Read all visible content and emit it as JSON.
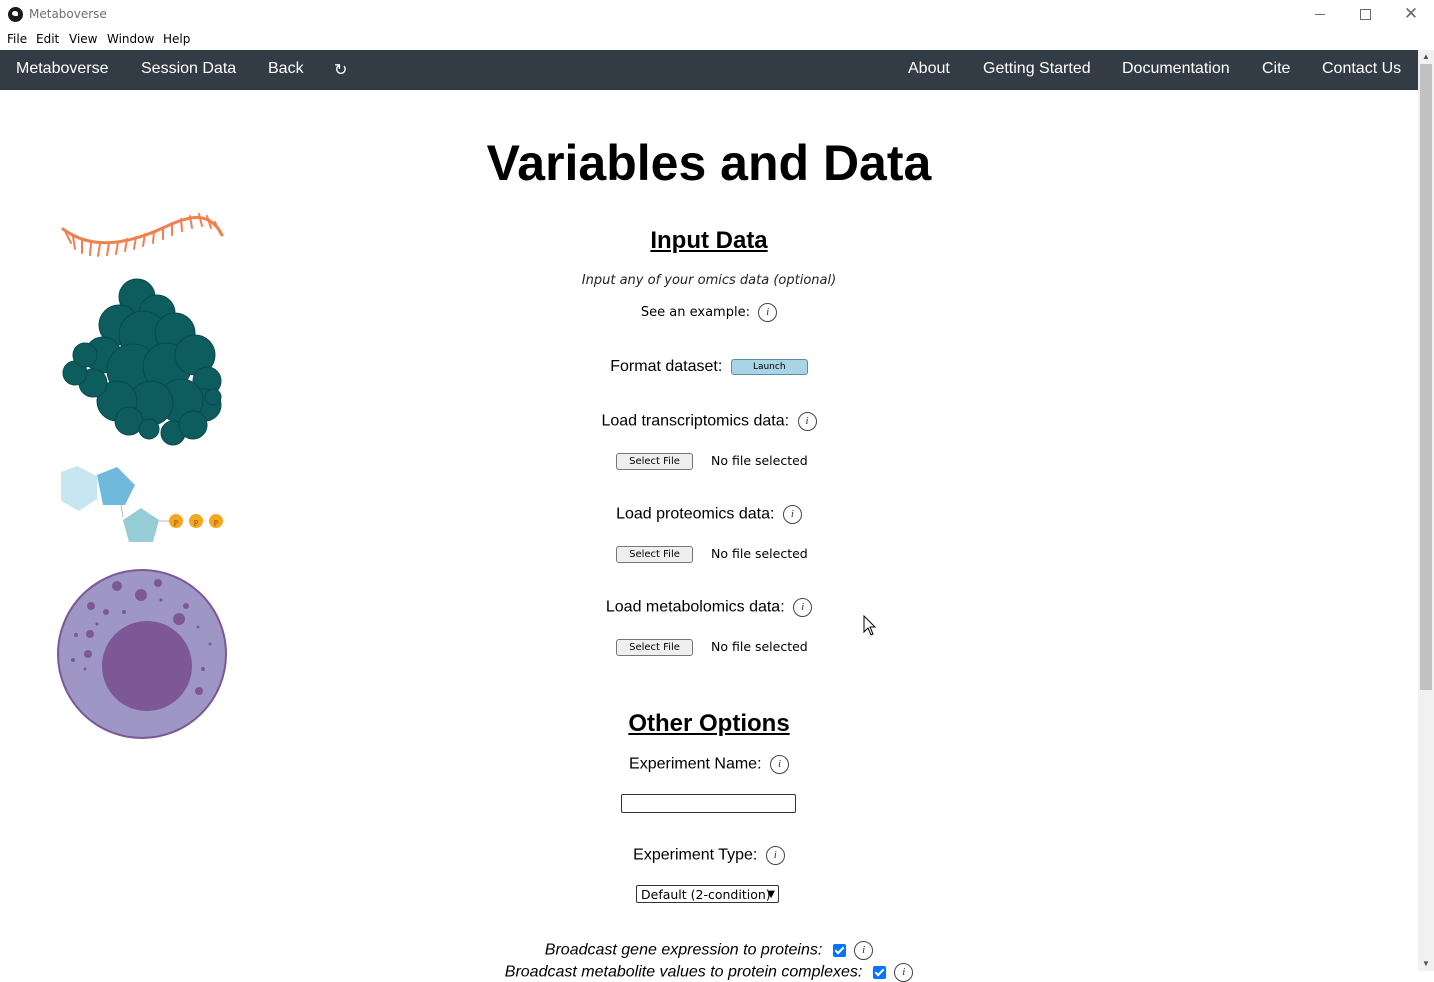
{
  "window": {
    "title": "Metaboverse"
  },
  "menu": [
    "File",
    "Edit",
    "View",
    "Window",
    "Help"
  ],
  "nav": {
    "left": [
      "Metaboverse",
      "Session Data",
      "Back"
    ],
    "refresh_glyph": "↻",
    "right": [
      "About",
      "Getting Started",
      "Documentation",
      "Cite",
      "Contact Us"
    ]
  },
  "page": {
    "title": "Variables and Data"
  },
  "input_data": {
    "heading": "Input Data",
    "note": "Input any of your omics data (optional)",
    "example_label": "See an example:",
    "format_label": "Format dataset:",
    "launch_label": "Launch",
    "transcriptomics_label": "Load transcriptomics data:",
    "proteomics_label": "Load proteomics data:",
    "metabolomics_label": "Load metabolomics data:",
    "select_file_label": "Select File",
    "no_file_text": "No file selected"
  },
  "other_options": {
    "heading": "Other Options",
    "experiment_name_label": "Experiment Name:",
    "experiment_name_value": "",
    "experiment_type_label": "Experiment Type:",
    "experiment_type_value": "Default (2-condition)",
    "broadcast_gene_label": "Broadcast gene expression to proteins:",
    "broadcast_gene_checked": true,
    "broadcast_metab_label": "Broadcast metabolite values to protein complexes:",
    "broadcast_metab_checked": true
  },
  "info_glyph": "i",
  "colors": {
    "navbar": "#333c44",
    "launch_button": "#a9d4e6",
    "rna": "#f0804e",
    "protein": "#0d5c5e",
    "cell": "#9e96c4",
    "nucleus": "#7e5796",
    "phosphate": "#f5a623"
  }
}
